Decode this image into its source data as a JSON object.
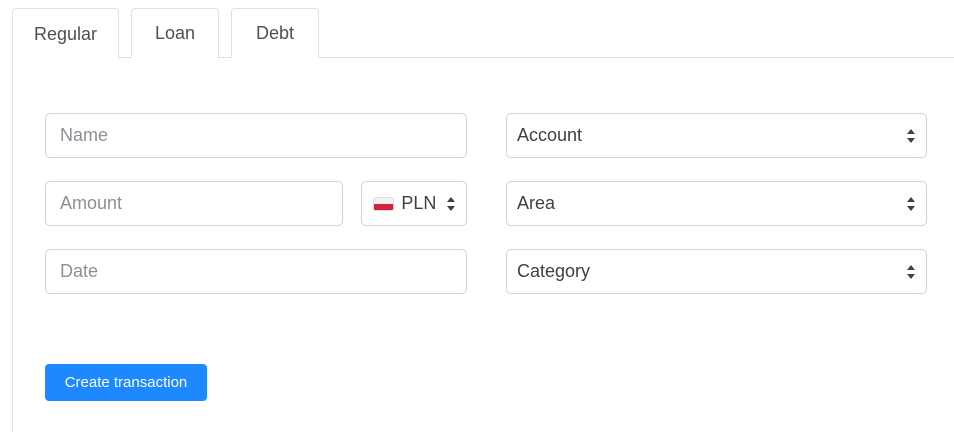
{
  "tabs": [
    {
      "label": "Regular",
      "active": true
    },
    {
      "label": "Loan",
      "active": false
    },
    {
      "label": "Debt",
      "active": false
    }
  ],
  "form": {
    "name": {
      "value": "",
      "placeholder": "Name"
    },
    "amount": {
      "value": "",
      "placeholder": "Amount"
    },
    "date": {
      "value": "",
      "placeholder": "Date"
    },
    "currency": {
      "selected": "PLN",
      "flag_icon": "poland-flag-icon"
    },
    "account": {
      "selected": "Account"
    },
    "area": {
      "selected": "Area"
    },
    "category": {
      "selected": "Category"
    }
  },
  "actions": {
    "create_label": "Create transaction"
  },
  "colors": {
    "primary": "#1e88ff",
    "border": "#ced4da",
    "tab_border": "#dee2e6"
  }
}
